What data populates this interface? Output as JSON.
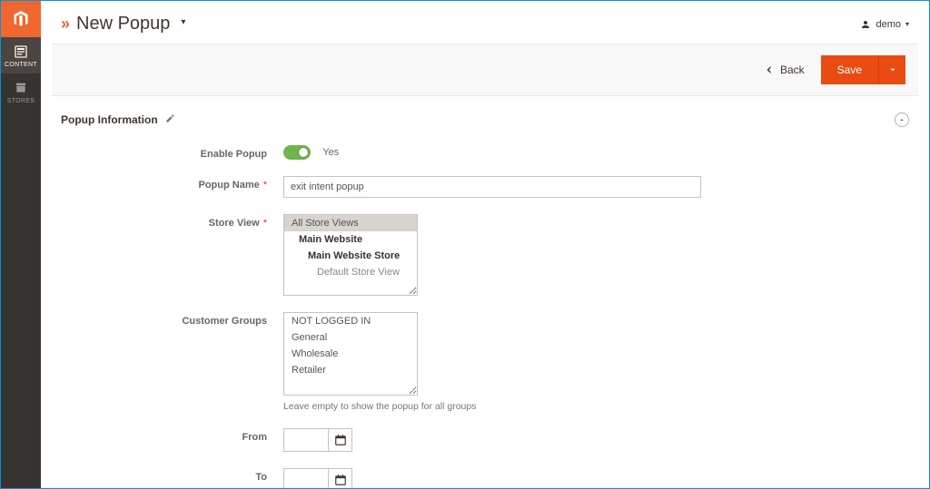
{
  "rail": {
    "items": [
      {
        "label": "CONTENT"
      },
      {
        "label": "STORES"
      }
    ]
  },
  "header": {
    "page_title": "New Popup",
    "user_label": "demo"
  },
  "actions": {
    "back_label": "Back",
    "save_label": "Save"
  },
  "section": {
    "title": "Popup Information"
  },
  "form": {
    "enable_popup": {
      "label": "Enable Popup",
      "value_text": "Yes"
    },
    "popup_name": {
      "label": "Popup Name",
      "value": "exit intent popup"
    },
    "store_view": {
      "label": "Store View",
      "options": [
        {
          "text": "All Store Views",
          "selected": true
        },
        {
          "text": "Main Website",
          "bold": true,
          "indent": 1
        },
        {
          "text": "Main Website Store",
          "bold": true,
          "indent": 2
        },
        {
          "text": "Default Store View",
          "indent": 3
        }
      ]
    },
    "customer_groups": {
      "label": "Customer Groups",
      "helper": "Leave empty to show the popup for all groups",
      "options": [
        {
          "text": "NOT LOGGED IN"
        },
        {
          "text": "General"
        },
        {
          "text": "Wholesale"
        },
        {
          "text": "Retailer"
        }
      ]
    },
    "from": {
      "label": "From",
      "value": ""
    },
    "to": {
      "label": "To",
      "value": ""
    }
  }
}
